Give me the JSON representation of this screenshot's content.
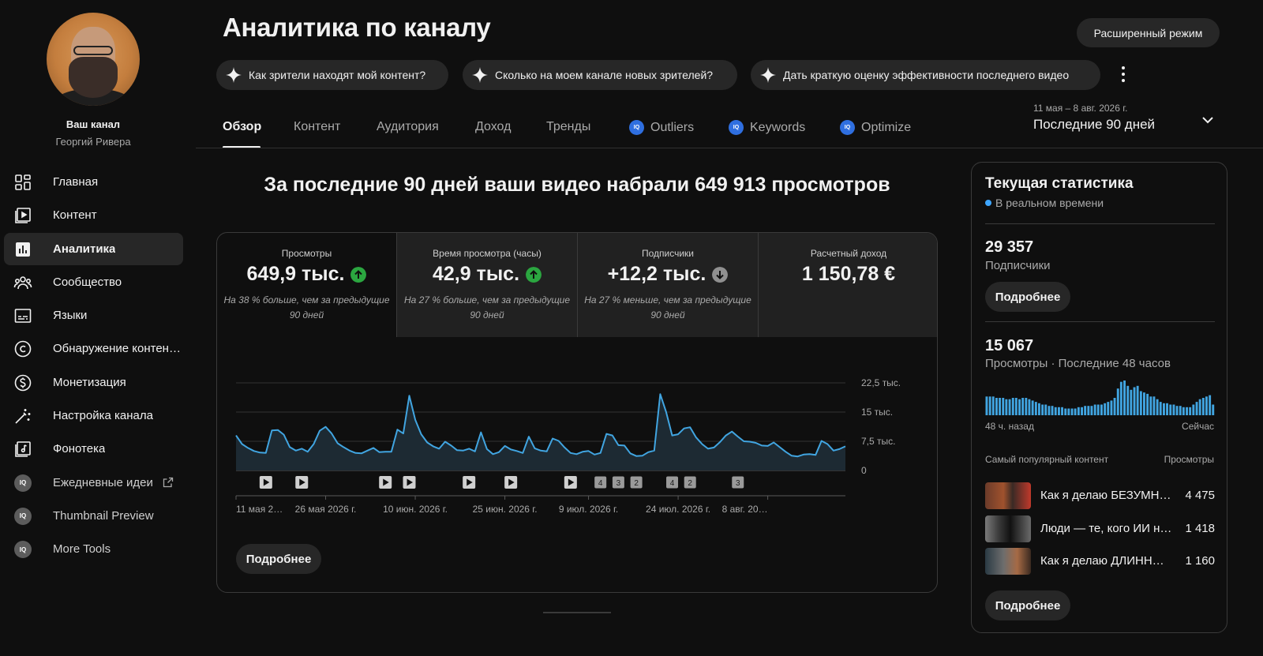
{
  "sidebar": {
    "channel_label": "Ваш канал",
    "channel_name": "Георгий Ривера",
    "items": [
      {
        "label": "Главная",
        "icon": "dashboard-icon"
      },
      {
        "label": "Контент",
        "icon": "content-icon"
      },
      {
        "label": "Аналитика",
        "icon": "analytics-icon",
        "active": true
      },
      {
        "label": "Сообщество",
        "icon": "community-icon"
      },
      {
        "label": "Языки",
        "icon": "subtitles-icon"
      },
      {
        "label": "Обнаружение контен…",
        "icon": "copyright-icon"
      },
      {
        "label": "Монетизация",
        "icon": "monetization-icon"
      },
      {
        "label": "Настройка канала",
        "icon": "magic-wand-icon"
      },
      {
        "label": "Фонотека",
        "icon": "audio-library-icon"
      },
      {
        "label": "Ежедневные идеи",
        "icon": "iq-icon",
        "external": true
      },
      {
        "label": "Thumbnail Preview",
        "icon": "iq-icon"
      },
      {
        "label": "More Tools",
        "icon": "iq-icon"
      }
    ]
  },
  "header": {
    "title": "Аналитика по каналу",
    "advanced_mode": "Расширенный режим",
    "chips": [
      "Как зрители находят мой контент?",
      "Сколько на моем канале новых зрителей?",
      "Дать краткую оценку эффективности последнего видео"
    ]
  },
  "tabs": [
    "Обзор",
    "Контент",
    "Аудитория",
    "Доход",
    "Тренды",
    "Outliers",
    "Keywords",
    "Optimize"
  ],
  "date": {
    "range": "11 мая – 8 авг. 2026 г.",
    "preset": "Последние 90 дней"
  },
  "main": {
    "headline": "За последние 90 дней ваши видео набрали 649 913 просмотров",
    "metrics": [
      {
        "label": "Просмотры",
        "value": "649,9 тыс.",
        "trend": "up",
        "note": "На 38 % больше, чем за предыдущие 90 дней"
      },
      {
        "label": "Время просмотра (часы)",
        "value": "42,9 тыс.",
        "trend": "up",
        "note": "На 27 % больше, чем за предыдущие 90 дней"
      },
      {
        "label": "Подписчики",
        "value": "+12,2 тыс.",
        "trend": "down",
        "note": "На 27 % меньше, чем за предыдущие 90 дней"
      },
      {
        "label": "Расчетный доход",
        "value": "1 150,78 €",
        "trend": "",
        "note": ""
      }
    ],
    "more_button": "Подробнее"
  },
  "colors": {
    "accent_line": "#41a5e1",
    "up": "#2ba640",
    "down": "#909090"
  },
  "chart_data": {
    "type": "area",
    "y_ticks": [
      "22,5 тыс.",
      "15 тыс.",
      "7,5 тыс.",
      "0"
    ],
    "ylim": [
      0,
      22500
    ],
    "x_tick_labels": [
      "11 мая 2…",
      "26 мая 2026 г.",
      "10 июн. 2026 г.",
      "25 июн. 2026 г.",
      "9 июл. 2026 г.",
      "24 июл. 2026 г.",
      "8 авг. 20…"
    ],
    "x_tick_days": [
      0,
      15,
      30,
      45,
      59,
      74,
      89
    ],
    "values": [
      9000,
      6800,
      5800,
      5000,
      4600,
      4500,
      10300,
      10400,
      9200,
      6000,
      5100,
      5600,
      4800,
      6800,
      10200,
      11200,
      9500,
      7000,
      6000,
      5100,
      4500,
      4400,
      5100,
      5800,
      4700,
      4800,
      4800,
      10500,
      9500,
      19200,
      13000,
      9300,
      7200,
      6200,
      5600,
      7400,
      6400,
      5200,
      5100,
      5600,
      4900,
      9800,
      5500,
      4200,
      4700,
      6300,
      5400,
      5000,
      4500,
      8700,
      5700,
      5100,
      4900,
      8200,
      7600,
      5900,
      4500,
      4200,
      4800,
      5000,
      4100,
      4500,
      9400,
      9000,
      6500,
      6400,
      4400,
      3700,
      3800,
      4700,
      5100,
      19600,
      15000,
      9000,
      9300,
      10800,
      11100,
      8500,
      6800,
      5600,
      5900,
      7300,
      9000,
      10000,
      8700,
      7500,
      7400,
      7100,
      6400,
      6300,
      7200,
      6000,
      4800,
      3800,
      3600,
      4100,
      4200,
      4000,
      7600,
      6800,
      5100,
      5500,
      6200
    ],
    "markers": [
      {
        "x_index": 5,
        "label": "▶"
      },
      {
        "x_index": 11,
        "label": "▶"
      },
      {
        "x_index": 25,
        "label": "▶"
      },
      {
        "x_index": 29,
        "label": "▶"
      },
      {
        "x_index": 39,
        "label": "▶"
      },
      {
        "x_index": 46,
        "label": "▶"
      },
      {
        "x_index": 56,
        "label": "▶"
      },
      {
        "x_index": 61,
        "label": "4"
      },
      {
        "x_index": 64,
        "label": "3"
      },
      {
        "x_index": 67,
        "label": "2"
      },
      {
        "x_index": 73,
        "label": "4"
      },
      {
        "x_index": 76,
        "label": "2"
      },
      {
        "x_index": 84,
        "label": "3"
      }
    ]
  },
  "realtime": {
    "title": "Текущая статистика",
    "live": "В реальном времени",
    "subscribers_value": "29 357",
    "subscribers_label": "Подписчики",
    "more_button": "Подробнее",
    "views_value": "15 067",
    "views_label": "Просмотры · Последние 48 часов",
    "bars": [
      14,
      14,
      14,
      13,
      13,
      13,
      12,
      12,
      13,
      13,
      12,
      13,
      13,
      12,
      11,
      10,
      9,
      8,
      8,
      7,
      7,
      6,
      6,
      6,
      5,
      5,
      5,
      5,
      6,
      6,
      7,
      7,
      7,
      8,
      8,
      8,
      9,
      10,
      11,
      13,
      20,
      25,
      26,
      22,
      19,
      21,
      22,
      18,
      17,
      16,
      14,
      14,
      12,
      10,
      9,
      9,
      8,
      8,
      7,
      7,
      6,
      6,
      6,
      8,
      10,
      12,
      13,
      14,
      15,
      8
    ],
    "start_label": "48 ч. назад",
    "end_label": "Сейчас",
    "top_header": "Самый популярный контент",
    "top_col": "Просмотры",
    "top_items": [
      {
        "title": "Как я делаю БЕЗУМН…",
        "views": "4 475"
      },
      {
        "title": "Люди — те, кого ИИ н…",
        "views": "1 418"
      },
      {
        "title": "Как я делаю ДЛИНН…",
        "views": "1 160"
      }
    ],
    "more_button_2": "Подробнее"
  }
}
